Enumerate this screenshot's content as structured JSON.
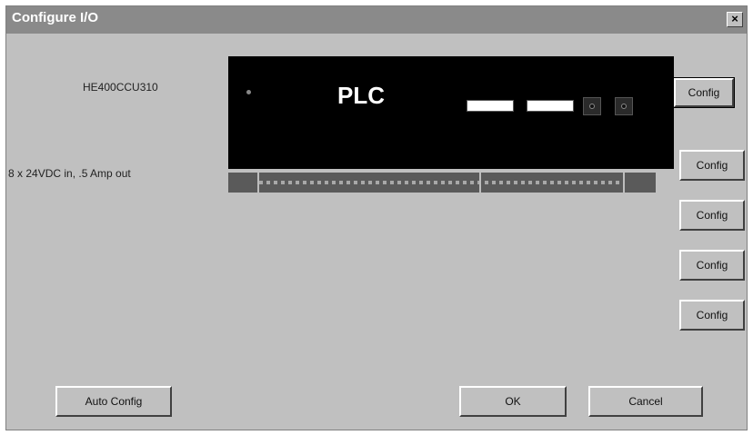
{
  "window": {
    "title": "Configure I/O",
    "close_glyph": "×"
  },
  "module": {
    "cpu_model": "HE400CCU310",
    "io_description": "8 x 24VDC in, .5 Amp out",
    "plc_label": "PLC"
  },
  "config_buttons": [
    "Config",
    "Config",
    "Config",
    "Config",
    "Config"
  ],
  "footer": {
    "auto_config": "Auto Config",
    "ok": "OK",
    "cancel": "Cancel"
  }
}
